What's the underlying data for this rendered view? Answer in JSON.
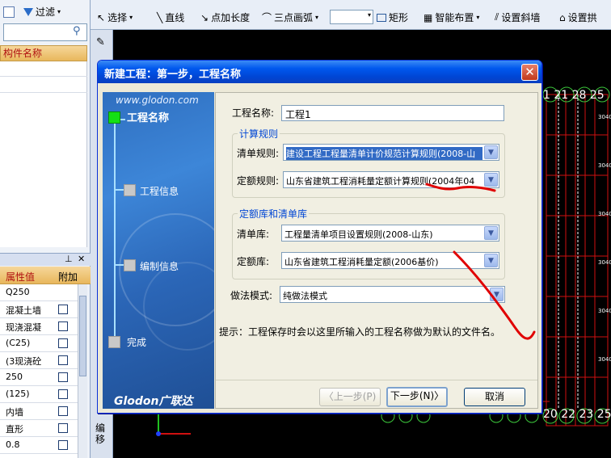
{
  "app": {
    "toolbar": {
      "filter_label": "过滤",
      "select_label": "选择",
      "line_label": "直线",
      "point_length_label": "点加长度",
      "arc_label": "三点画弧",
      "rect_label": "矩形",
      "smart_layout_label": "智能布置",
      "set_slope_wall_label": "设置斜墙",
      "set_arch_label": "设置拱"
    },
    "left_panel": {
      "column_header": "构件名称"
    },
    "properties": {
      "header_value": "属性值",
      "header_extra": "附加",
      "values": [
        "Q250",
        "混凝土墙",
        "现浇混凝",
        "(C25)",
        "(3现浇砼",
        "250",
        "(125)",
        "内墙",
        "直形",
        "0.8"
      ]
    },
    "vstrip_label": "编\n移",
    "canvas_numbers_top": "1 21 28 25",
    "canvas_numbers_bottom": "20 22 23 25"
  },
  "dialog": {
    "title": "新建工程：第一步，工程名称",
    "close": "✕",
    "side": {
      "url": "www.glodon.com",
      "logo": "Glodon广联达",
      "steps": [
        {
          "label": "工程名称",
          "active": true
        },
        {
          "label": "工程信息",
          "active": false
        },
        {
          "label": "编制信息",
          "active": false
        },
        {
          "label": "完成",
          "active": false
        }
      ]
    },
    "form": {
      "project_name_label": "工程名称:",
      "project_name_value": "工程1",
      "calc_rules_title": "计算规则",
      "list_rule_label": "清单规则:",
      "list_rule_value": "建设工程工程量清单计价规范计算规则(2008-山",
      "quota_rule_label": "定额规则:",
      "quota_rule_value": "山东省建筑工程消耗量定额计算规则(2004年04",
      "library_title": "定额库和清单库",
      "list_lib_label": "清单库:",
      "list_lib_value": "工程量清单项目设置规则(2008-山东)",
      "quota_lib_label": "定额库:",
      "quota_lib_value": "山东省建筑工程消耗量定额(2006基价)",
      "method_label": "做法模式:",
      "method_value": "纯做法模式",
      "hint": "提示：工程保存时会以这里所输入的工程名称做为默认的文件名。"
    },
    "buttons": {
      "prev": "〈上一步(P)",
      "next": "下一步(N)〉",
      "cancel": "取消"
    }
  },
  "colors": {
    "titlebar": "#0058ee",
    "annotation": "#e00000",
    "active_step": "#14e014"
  }
}
